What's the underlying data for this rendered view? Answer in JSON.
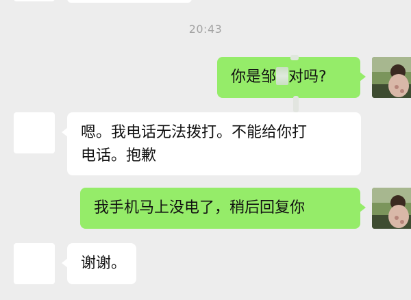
{
  "timestamp": "20:43",
  "messages": [
    {
      "side": "right",
      "text_before": "你是邹",
      "text_after": "对吗?"
    },
    {
      "side": "left",
      "line1": "嗯。我电话无法拨打。不能给你打",
      "line2": "电话。抱歉"
    },
    {
      "side": "right",
      "text": "我手机马上没电了，稍后回复你"
    },
    {
      "side": "left",
      "text": "谢谢。"
    }
  ],
  "colors": {
    "background": "#ededed",
    "outgoing_bubble": "#95ec69",
    "incoming_bubble": "#ffffff",
    "timestamp_text": "#a3a3a3"
  }
}
